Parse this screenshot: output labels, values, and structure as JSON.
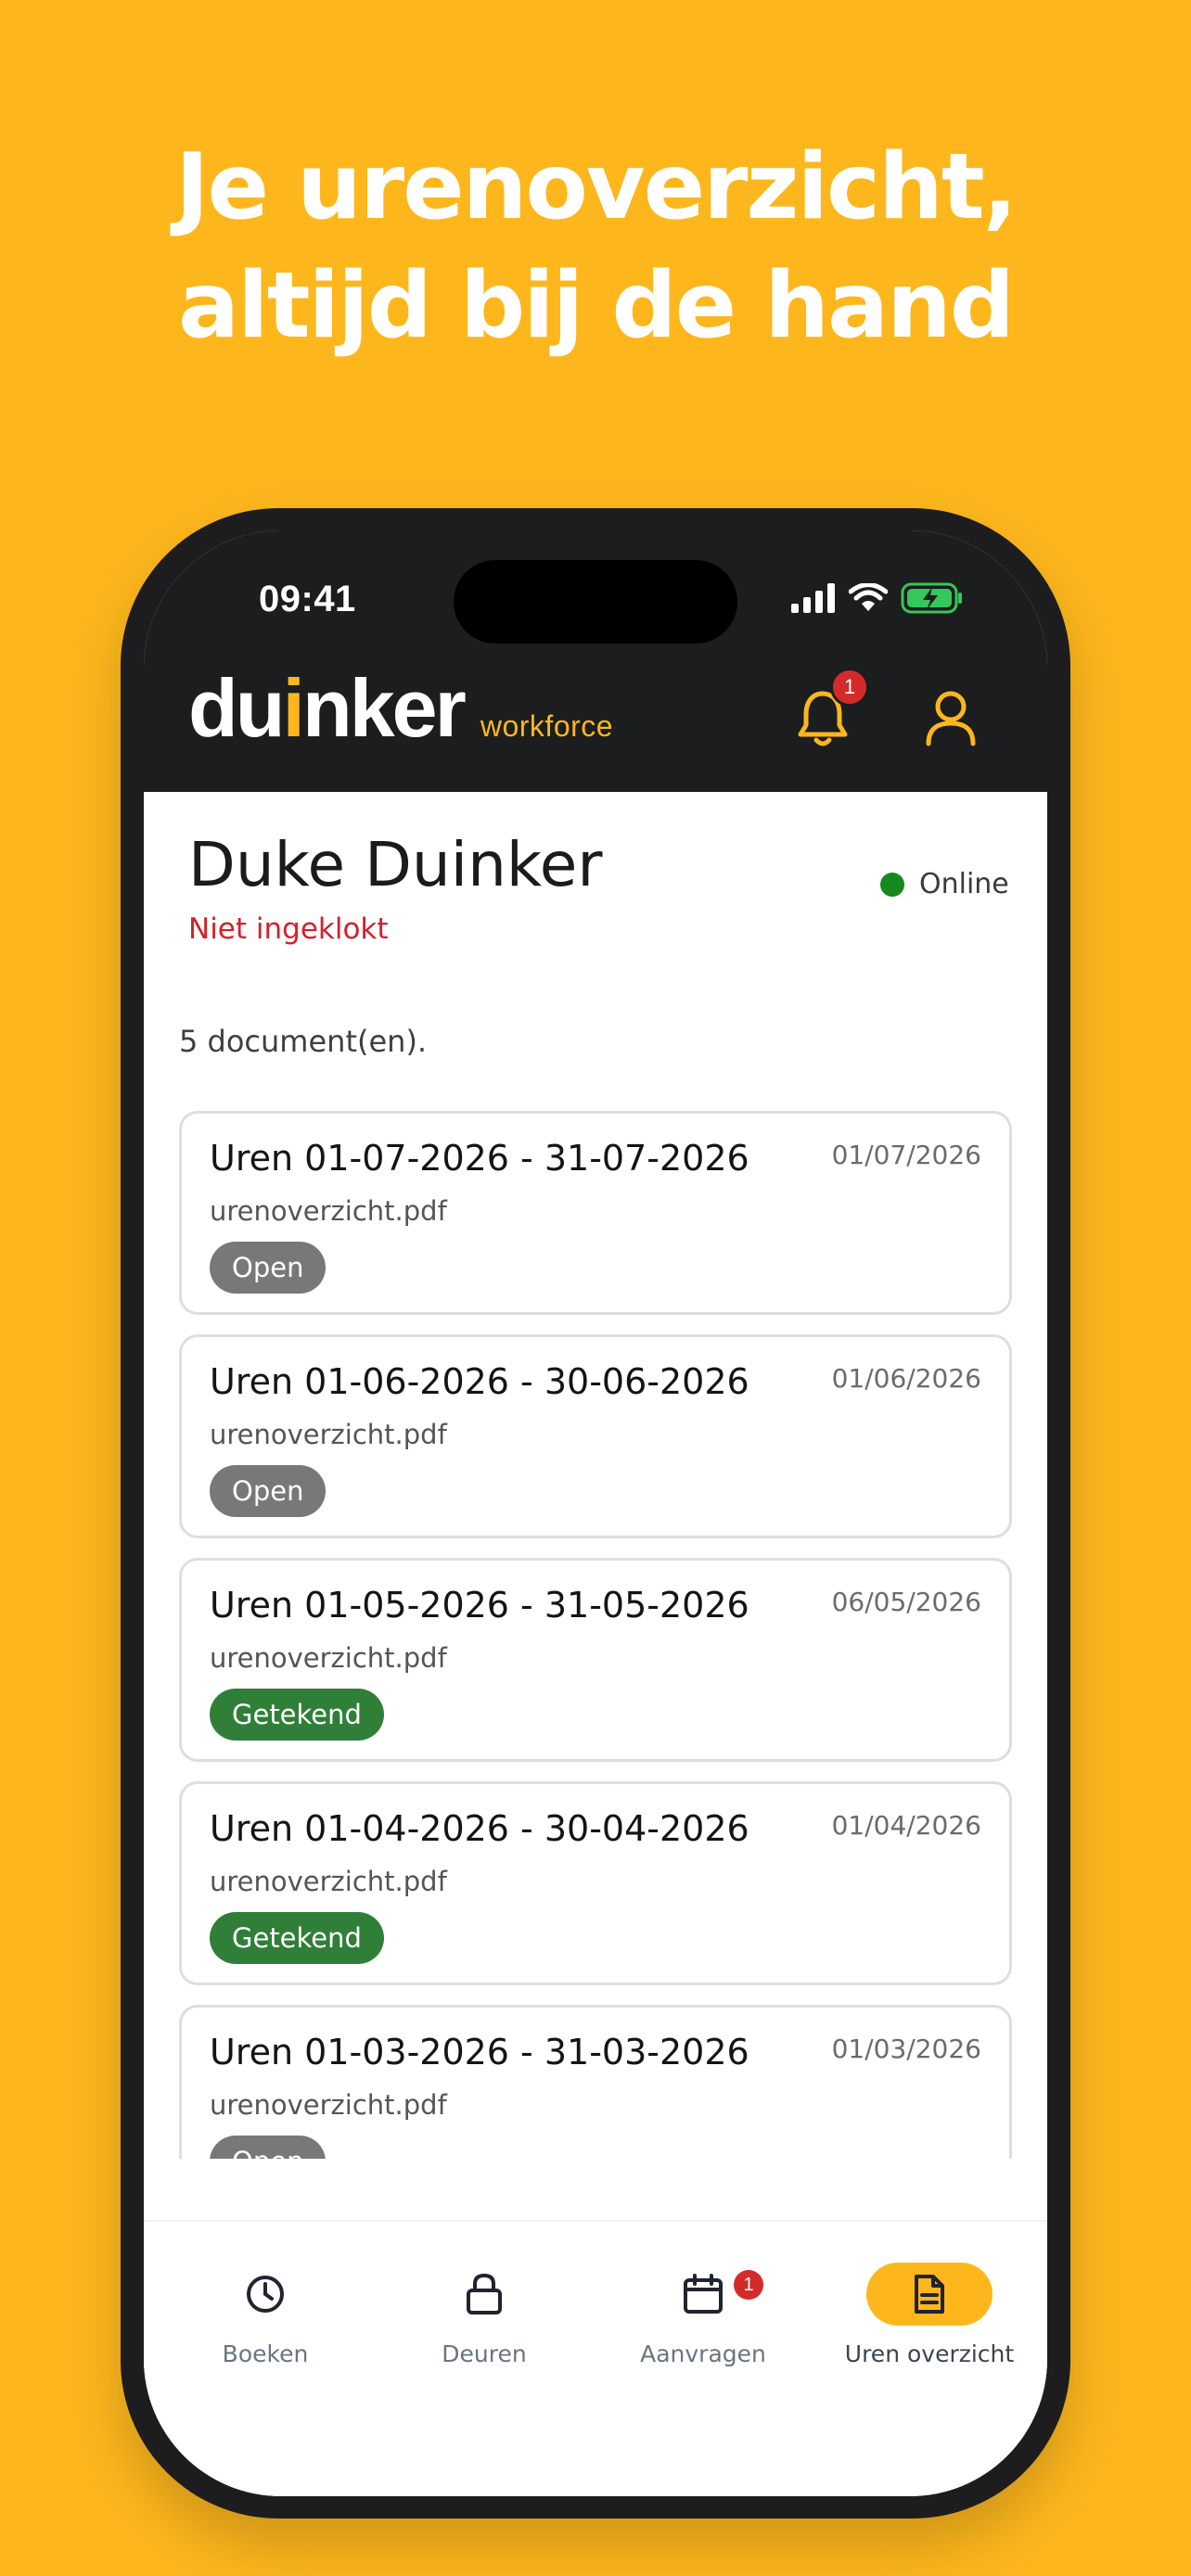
{
  "headline": {
    "line1": "Je urenoverzicht,",
    "line2": "altijd bij de hand"
  },
  "status_bar": {
    "time": "09:41"
  },
  "header": {
    "brand_pre": "du",
    "brand_i": "i",
    "brand_post": "nker",
    "brand_sub": "workforce",
    "notification_count": "1"
  },
  "user": {
    "name": "Duke Duinker",
    "clock_state": "Niet ingeklokt",
    "presence": "Online"
  },
  "documents": {
    "count_label": "5 document(en).",
    "items": [
      {
        "title": "Uren 01-07-2026 - 31-07-2026",
        "date": "01/07/2026",
        "file": "urenoverzicht.pdf",
        "status": "Open"
      },
      {
        "title": "Uren 01-06-2026 - 30-06-2026",
        "date": "01/06/2026",
        "file": "urenoverzicht.pdf",
        "status": "Open"
      },
      {
        "title": "Uren 01-05-2026 - 31-05-2026",
        "date": "06/05/2026",
        "file": "urenoverzicht.pdf",
        "status": "Getekend"
      },
      {
        "title": "Uren 01-04-2026 - 30-04-2026",
        "date": "01/04/2026",
        "file": "urenoverzicht.pdf",
        "status": "Getekend"
      },
      {
        "title": "Uren 01-03-2026 - 31-03-2026",
        "date": "01/03/2026",
        "file": "urenoverzicht.pdf",
        "status": "Open"
      }
    ]
  },
  "nav": {
    "items": [
      {
        "label": "Boeken",
        "icon": "clock-icon"
      },
      {
        "label": "Deuren",
        "icon": "lock-icon"
      },
      {
        "label": "Aanvragen",
        "icon": "calendar-icon",
        "badge": "1"
      },
      {
        "label": "Uren overzicht",
        "icon": "document-icon",
        "active": true
      }
    ]
  },
  "colors": {
    "background": "#FDB71D",
    "header": "#1b1d1f",
    "accent": "#FDB71D",
    "open_badge": "#787878",
    "signed_badge": "#2f7f38",
    "alert": "#d52a2a",
    "online": "#16891c"
  }
}
